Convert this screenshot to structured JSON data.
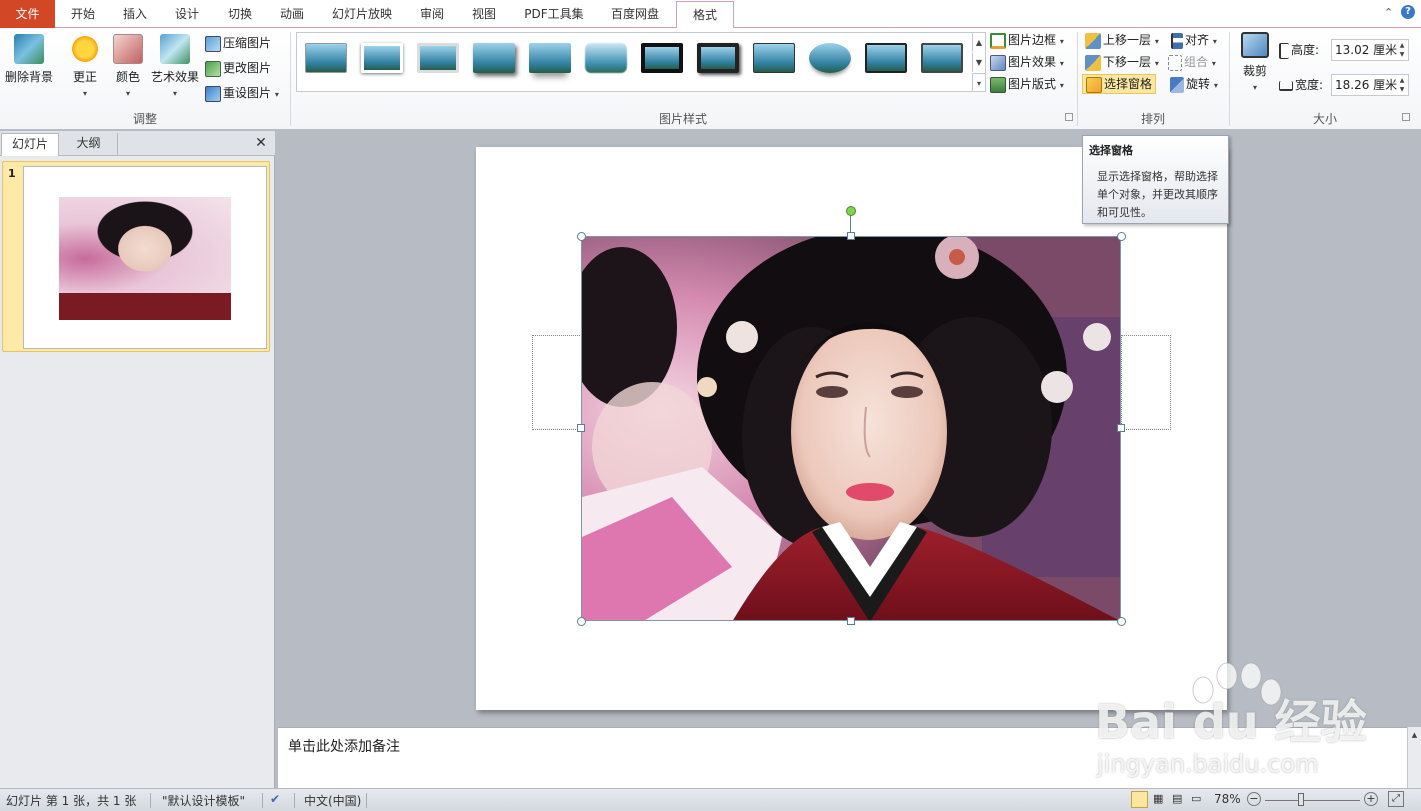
{
  "tabs": {
    "file": "文件",
    "home": "开始",
    "insert": "插入",
    "design": "设计",
    "transitions": "切换",
    "animations": "动画",
    "slideshow": "幻灯片放映",
    "review": "审阅",
    "view": "视图",
    "pdf": "PDF工具集",
    "baidu": "百度网盘",
    "format": "格式"
  },
  "ribbon": {
    "adjust": {
      "remove_bg": "删除背景",
      "corrections": "更正",
      "color": "颜色",
      "artistic": "艺术效果",
      "compress": "压缩图片",
      "change": "更改图片",
      "reset": "重设图片",
      "group_label": "调整"
    },
    "styles": {
      "border": "图片边框",
      "effects": "图片效果",
      "layout": "图片版式",
      "group_label": "图片样式"
    },
    "arrange": {
      "bring_forward": "上移一层",
      "send_backward": "下移一层",
      "selection_pane": "选择窗格",
      "align": "对齐",
      "group": "组合",
      "rotate": "旋转",
      "group_label": "排列"
    },
    "size": {
      "crop": "裁剪",
      "height_label": "高度:",
      "height_value": "13.02 厘米",
      "width_label": "宽度:",
      "width_value": "18.26 厘米",
      "group_label": "大小"
    }
  },
  "tooltip": {
    "title": "选择窗格",
    "body": "显示选择窗格，帮助选择单个对象，并更改其顺序和可见性。"
  },
  "left_panel": {
    "tab_slides": "幻灯片",
    "tab_outline": "大纲",
    "close": "✕",
    "slide_number": "1"
  },
  "notes": {
    "placeholder": "单击此处添加备注"
  },
  "status": {
    "slide_info": "幻灯片 第 1 张，共 1 张",
    "theme": "\"默认设计模板\"",
    "language": "中文(中国)",
    "zoom": "78%"
  },
  "watermark": {
    "brand": "Bai du 经验",
    "url": "jingyan.baidu.com"
  },
  "colors": {
    "file_tab": "#d24726",
    "format_border": "#cf9fc8",
    "selection_highlight": "#fce7a0"
  }
}
